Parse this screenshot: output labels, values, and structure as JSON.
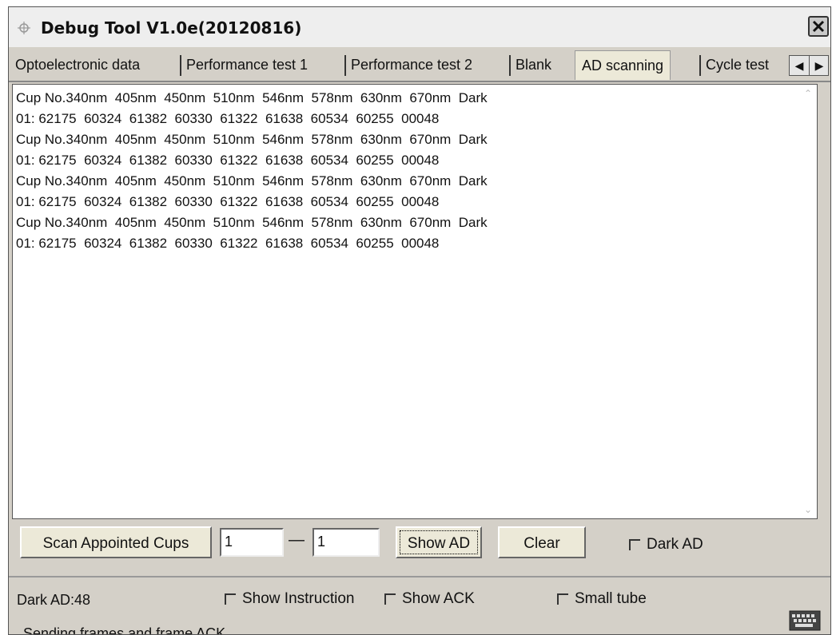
{
  "window": {
    "title": "Debug Tool V1.0e(20120816)"
  },
  "tabs": [
    {
      "label": "Optoelectronic data"
    },
    {
      "label": "Performance test 1"
    },
    {
      "label": "Performance test 2"
    },
    {
      "label": "Blank"
    },
    {
      "label": "AD scanning",
      "active": true
    },
    {
      "label": "Cycle test"
    }
  ],
  "output": {
    "lines": [
      "Cup No.340nm  405nm  450nm  510nm  546nm  578nm  630nm  670nm  Dark",
      "01: 62175  60324  61382  60330  61322  61638  60534  60255  00048",
      "Cup No.340nm  405nm  450nm  510nm  546nm  578nm  630nm  670nm  Dark",
      "01: 62175  60324  61382  60330  61322  61638  60534  60255  00048",
      "Cup No.340nm  405nm  450nm  510nm  546nm  578nm  630nm  670nm  Dark",
      "01: 62175  60324  61382  60330  61322  61638  60534  60255  00048",
      "Cup No.340nm  405nm  450nm  510nm  546nm  578nm  630nm  670nm  Dark",
      "01: 62175  60324  61382  60330  61322  61638  60534  60255  00048"
    ]
  },
  "controls": {
    "scan_button": "Scan Appointed Cups",
    "from_value": "1",
    "range_dash": "—",
    "to_value": "1",
    "show_ad_button": "Show AD",
    "clear_button": "Clear",
    "dark_ad_label": "Dark AD"
  },
  "status": {
    "dark_ad_readout": "Dark AD:48",
    "show_instruction_label": "Show Instruction",
    "show_ack_label": "Show ACK",
    "small_tube_label": "Small tube",
    "group_label": "Sending frames and frame ACK"
  }
}
